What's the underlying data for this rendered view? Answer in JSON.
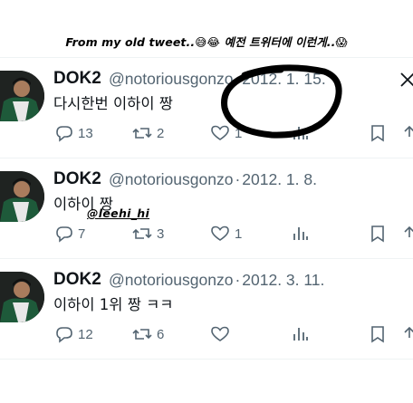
{
  "caption": "From my old tweet..😅😂 예전 트위터에 이런게..😱",
  "tweets": [
    {
      "name": "DOK2",
      "handle": "@notoriousgonzo",
      "date": "2012. 1. 15.",
      "text": "다시한번 이하이 짱",
      "replies": "13",
      "retweets": "2",
      "likes": "1"
    },
    {
      "name": "DOK2",
      "handle": "@notoriousgonzo",
      "date": "2012. 1. 8.",
      "text": "이하이 짱",
      "sticker": "@leehi_hi",
      "replies": "7",
      "retweets": "3",
      "likes": "1"
    },
    {
      "name": "DOK2",
      "handle": "@notoriousgonzo",
      "date": "2012. 3. 11.",
      "text": "이하이 1위 짱 ㅋㅋ",
      "replies": "12",
      "retweets": "6",
      "likes": ""
    }
  ],
  "icons": [
    "reply-icon",
    "retweet-icon",
    "like-icon",
    "views-icon",
    "bookmark-icon",
    "x-logo-icon"
  ],
  "colors": {
    "text": "#0f1419",
    "secondary": "#536471",
    "divider": "#eff3f4"
  }
}
